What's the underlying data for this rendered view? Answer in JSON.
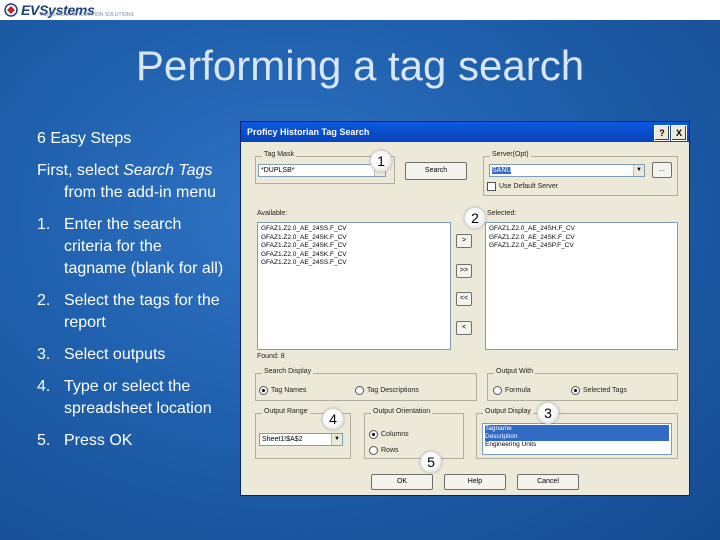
{
  "header": {
    "logo_text": "EVSystems",
    "logo_tagline": "INDUSTRIAL AUTOMATION SOLUTIONS"
  },
  "slide": {
    "title": "Performing a tag search",
    "intro": "6 Easy Steps",
    "first_prefix": "First, select ",
    "first_em": "Search Tags",
    "first_suffix": " from the add-in menu",
    "steps": [
      {
        "num": "1.",
        "text": "Enter the search criteria for the tagname (blank for all)"
      },
      {
        "num": "2.",
        "text": "Select the tags for the report"
      },
      {
        "num": "3.",
        "text": "Select outputs"
      },
      {
        "num": "4.",
        "text": "Type or select the spreadsheet location"
      },
      {
        "num": "5.",
        "text": "Press OK"
      }
    ]
  },
  "dialog": {
    "title": "Proficy Historian Tag Search",
    "help_glyph": "?",
    "close_glyph": "X",
    "tag_mask_label": "Tag Mask",
    "tag_mask_value": "*DUPLSB*",
    "search_button": "Search",
    "server_label": "Server(Opt)",
    "server_value": "SANU",
    "server_browse": "...",
    "use_default_server": "Use Default Server",
    "available_label": "Available:",
    "available_items": [
      "GFAZ1.Z2.0_AE_24SS.F_CV",
      "GFAZ1.Z2.0_AE_24SK.F_CV",
      "GFAZ1.Z2.0_AE_24SK.F_CV",
      "GFAZ1.Z2.0_AE_24SK.F_CV",
      "GFAZ1.Z2.0_AE_24SS.F_CV"
    ],
    "selected_label": "Selected:",
    "selected_items": [
      "GFAZ1.Z2.0_AE_24SH.F_CV",
      "GFAZ1.Z2.0_AE_24SK.F_CV",
      "GFAZ1.Z2.0_AE_24SP.F_CV"
    ],
    "move_right": ">",
    "move_all_right": ">>",
    "move_all_left": "<<",
    "move_left": "<",
    "found_text": "Found: 8",
    "search_display_label": "Search Display",
    "search_display_options": [
      "Tag Names",
      "Tag Descriptions"
    ],
    "output_with_label": "Output With",
    "output_with_options": [
      "Formula",
      "Selected Tags"
    ],
    "output_range_label": "Output Range",
    "output_range_value": "Sheet1!$A$2",
    "output_orientation_label": "Output Orientation",
    "output_orientation_options": [
      "Columns",
      "Rows"
    ],
    "output_display_label": "Output Display",
    "output_display_items": [
      "Tagname",
      "Description",
      "Engineering Units"
    ],
    "ok_button": "OK",
    "help_button": "Help",
    "cancel_button": "Cancel"
  },
  "callouts": [
    "1",
    "2",
    "3",
    "4",
    "5"
  ]
}
